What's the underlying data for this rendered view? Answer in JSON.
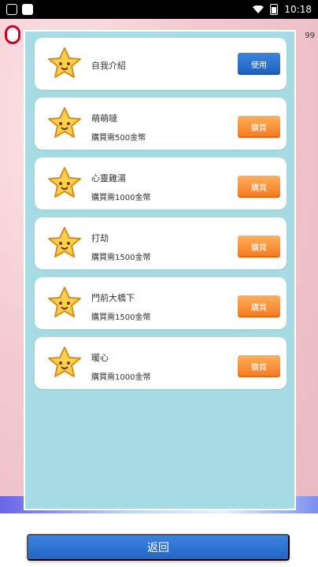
{
  "status_bar": {
    "time": "10:18",
    "icons": [
      "shield-icon",
      "square-icon",
      "wifi-icon",
      "battery-icon"
    ]
  },
  "background": {
    "right_partial_text": "99"
  },
  "items": [
    {
      "name": "自我介紹",
      "price": "",
      "action": "使用",
      "icon": "star-icon"
    },
    {
      "name": "萌萌噠",
      "price": "購買需500金幣",
      "action": "購買",
      "icon": "star-icon"
    },
    {
      "name": "心靈雞湯",
      "price": "購買需1000金幣",
      "action": "購買",
      "icon": "star-icon"
    },
    {
      "name": "打劫",
      "price": "購買需1500金幣",
      "action": "購買",
      "icon": "star-icon"
    },
    {
      "name": "門前大橋下",
      "price": "購買需1500金幣",
      "action": "購買",
      "icon": "star-icon"
    },
    {
      "name": "暖心",
      "price": "購買需1000金幣",
      "action": "購買",
      "icon": "star-icon"
    }
  ],
  "footer": {
    "return_label": "返回"
  },
  "colors": {
    "panel_bg": "#a7dbe4",
    "buy_button": "#f4781f",
    "use_button": "#1f5fba",
    "return_button": "#2365c4"
  }
}
